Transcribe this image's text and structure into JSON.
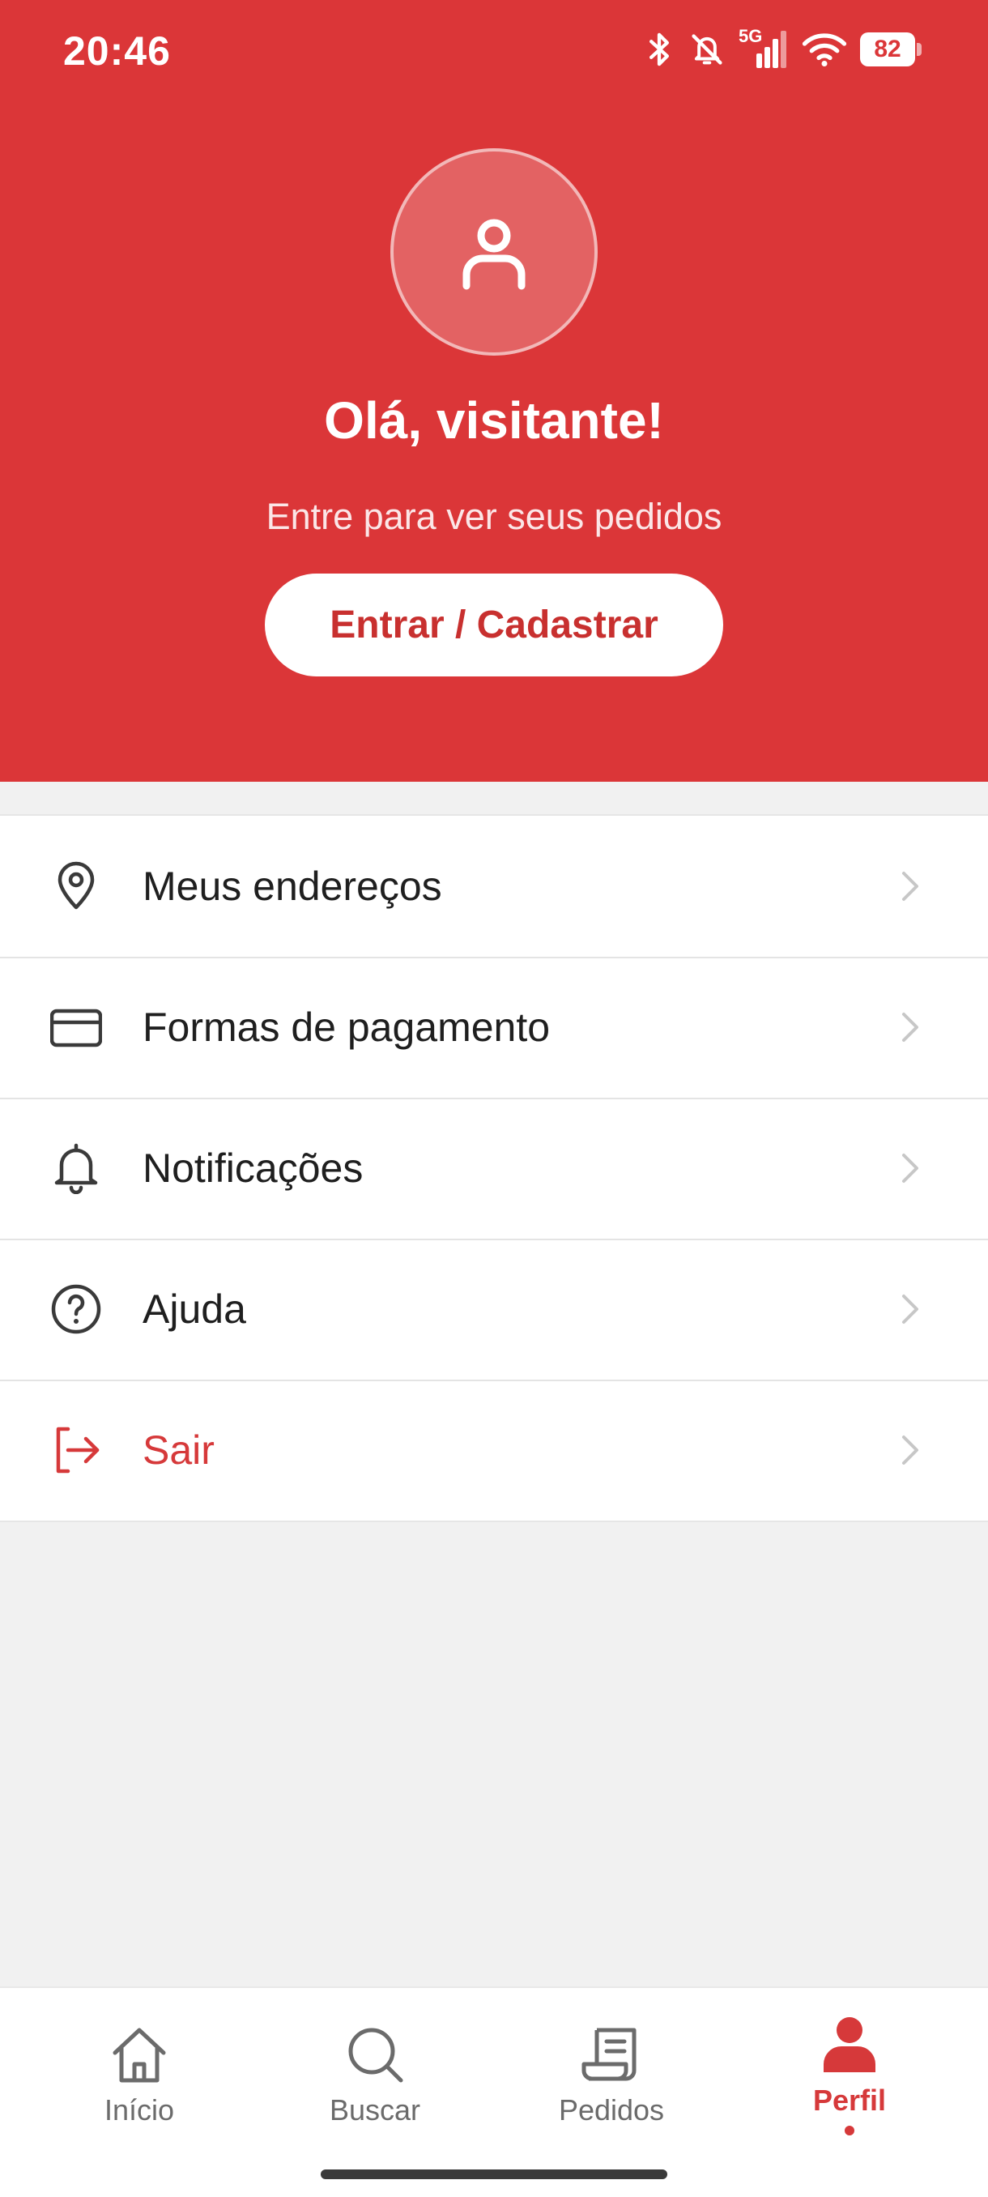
{
  "status_bar": {
    "time": "20:46",
    "network": "5G",
    "battery": "82",
    "icons": [
      "bluetooth-icon",
      "silent-icon",
      "signal-icon",
      "wifi-icon",
      "battery-icon"
    ]
  },
  "header": {
    "avatar_icon": "user-icon",
    "greeting": "Olá, visitante!",
    "subtitle": "Entre para ver seus pedidos",
    "login_button": "Entrar / Cadastrar",
    "background_color": "#db3638"
  },
  "menu": {
    "items": [
      {
        "label": "Meus endereços",
        "icon": "location-pin-icon"
      },
      {
        "label": "Formas de pagamento",
        "icon": "credit-card-icon"
      },
      {
        "label": "Notificações",
        "icon": "bell-icon"
      },
      {
        "label": "Ajuda",
        "icon": "help-circle-icon"
      },
      {
        "label": "Sair",
        "icon": "logout-icon",
        "color": "#d6393a"
      }
    ]
  },
  "bottom_nav": {
    "items": [
      {
        "label": "Início",
        "icon": "home-icon",
        "active": false
      },
      {
        "label": "Buscar",
        "icon": "search-icon",
        "active": false
      },
      {
        "label": "Pedidos",
        "icon": "receipt-icon",
        "active": false
      },
      {
        "label": "Perfil",
        "icon": "profile-icon",
        "active": true
      }
    ],
    "active_color": "#d6393a"
  }
}
